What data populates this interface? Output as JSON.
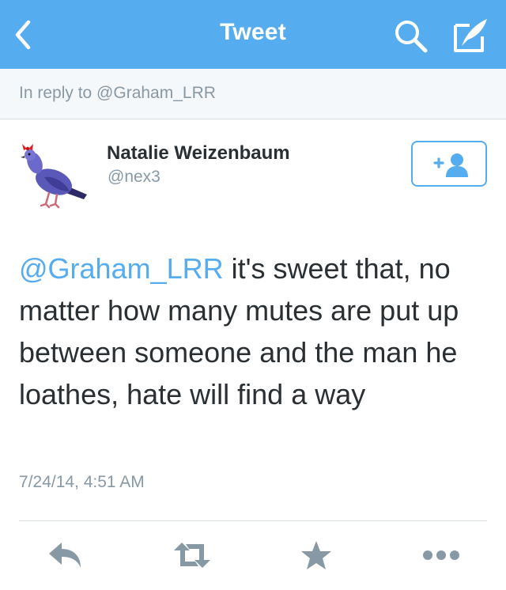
{
  "header": {
    "title": "Tweet",
    "background_color": "#55acee",
    "icons": [
      "back-arrow-icon",
      "search-icon",
      "compose-icon"
    ]
  },
  "reply_context": {
    "text": "In reply to @Graham_LRR"
  },
  "author": {
    "name": "Natalie Weizenbaum",
    "handle": "@nex3",
    "avatar": "pigeon-with-red-bow",
    "follow_icon": "add-user-icon"
  },
  "tweet": {
    "mention": "@Graham_LRR",
    "body": " it's sweet that, no matter how many mutes are put up between someone and the man he loathes, hate will find a way",
    "timestamp": "7/24/14, 4:51 AM"
  },
  "actions": {
    "icons": [
      "reply-icon",
      "retweet-icon",
      "favorite-star-icon",
      "more-options-icon"
    ],
    "icon_color": "#8899a6"
  },
  "colors": {
    "accent": "#55acee",
    "text": "#292f33",
    "muted": "#8899a6",
    "reply_bar_background": "#f5f8fa"
  }
}
